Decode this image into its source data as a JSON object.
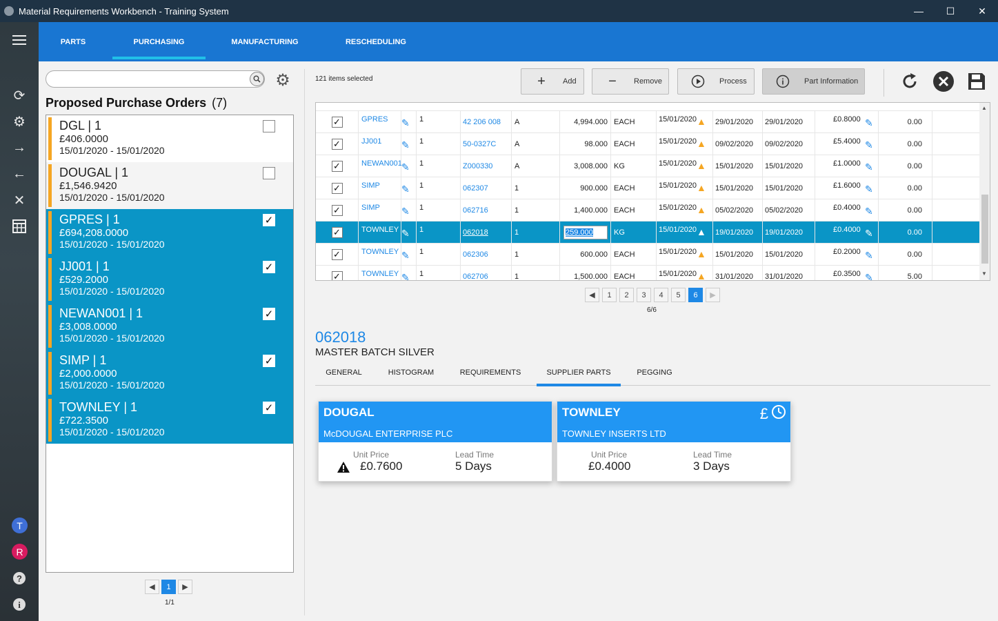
{
  "window": {
    "title": "Material Requirements Workbench - Training System",
    "minimize": "—",
    "maximize": "☐",
    "close": "✕"
  },
  "rail": {
    "avatar_t": "T",
    "avatar_r": "R",
    "colors": {
      "avatar_t": "#3f6fd6",
      "avatar_r": "#d81b60"
    }
  },
  "nav": {
    "tabs": [
      {
        "label": "PARTS"
      },
      {
        "label": "PURCHASING"
      },
      {
        "label": "MANUFACTURING"
      },
      {
        "label": "RESCHEDULING"
      }
    ],
    "active": "PURCHASING"
  },
  "left": {
    "search_placeholder": "",
    "title": "Proposed Purchase Orders",
    "count": "(7)",
    "orders": [
      {
        "name": "DGL | 1",
        "amount": "£406.0000",
        "dates": "15/01/2020 - 15/01/2020",
        "checked": false
      },
      {
        "name": "DOUGAL | 1",
        "amount": "£1,546.9420",
        "dates": "15/01/2020 - 15/01/2020",
        "checked": false
      },
      {
        "name": "GPRES | 1",
        "amount": "£694,208.0000",
        "dates": "15/01/2020 - 15/01/2020",
        "checked": true
      },
      {
        "name": "JJ001 | 1",
        "amount": "£529.2000",
        "dates": "15/01/2020 - 15/01/2020",
        "checked": true
      },
      {
        "name": "NEWAN001 | 1",
        "amount": "£3,008.0000",
        "dates": "15/01/2020 - 15/01/2020",
        "checked": true
      },
      {
        "name": "SIMP | 1",
        "amount": "£2,000.0000",
        "dates": "15/01/2020 - 15/01/2020",
        "checked": true
      },
      {
        "name": "TOWNLEY | 1",
        "amount": "£722.3500",
        "dates": "15/01/2020 - 15/01/2020",
        "checked": true
      }
    ],
    "pager": {
      "prev": "◀",
      "current": "1",
      "next": "▶",
      "info": "1/1"
    }
  },
  "toolbar": {
    "selected_info": "121 items selected",
    "add": "Add",
    "remove": "Remove",
    "process": "Process",
    "part_info": "Part Information"
  },
  "grid": {
    "rows": [
      {
        "supplier": "GPRES",
        "n": "1",
        "part": "42 206 008",
        "rev": "A",
        "qty": "4,994.000",
        "uom": "EACH",
        "date1": "15/01/2020",
        "date2": "29/01/2020",
        "date3": "29/01/2020",
        "price": "£0.8000",
        "extra": "0.00"
      },
      {
        "supplier": "JJ001",
        "n": "1",
        "part": "50-0327C",
        "rev": "A",
        "qty": "98.000",
        "uom": "EACH",
        "date1": "15/01/2020",
        "date2": "09/02/2020",
        "date3": "09/02/2020",
        "price": "£5.4000",
        "extra": "0.00"
      },
      {
        "supplier": "NEWAN001",
        "n": "1",
        "part": "Z000330",
        "rev": "A",
        "qty": "3,008.000",
        "uom": "KG",
        "date1": "15/01/2020",
        "date2": "15/01/2020",
        "date3": "15/01/2020",
        "price": "£1.0000",
        "extra": "0.00"
      },
      {
        "supplier": "SIMP",
        "n": "1",
        "part": "062307",
        "rev": "1",
        "qty": "900.000",
        "uom": "EACH",
        "date1": "15/01/2020",
        "date2": "15/01/2020",
        "date3": "15/01/2020",
        "price": "£1.6000",
        "extra": "0.00"
      },
      {
        "supplier": "SIMP",
        "n": "1",
        "part": "062716",
        "rev": "1",
        "qty": "1,400.000",
        "uom": "EACH",
        "date1": "15/01/2020",
        "date2": "05/02/2020",
        "date3": "05/02/2020",
        "price": "£0.4000",
        "extra": "0.00"
      },
      {
        "supplier": "TOWNLEY",
        "n": "1",
        "part": "062018",
        "rev": "1",
        "qty": "259.000",
        "uom": "KG",
        "date1": "15/01/2020",
        "date2": "19/01/2020",
        "date3": "19/01/2020",
        "price": "£0.4000",
        "extra": "0.00"
      },
      {
        "supplier": "TOWNLEY",
        "n": "1",
        "part": "062306",
        "rev": "1",
        "qty": "600.000",
        "uom": "EACH",
        "date1": "15/01/2020",
        "date2": "15/01/2020",
        "date3": "15/01/2020",
        "price": "£0.2000",
        "extra": "0.00"
      },
      {
        "supplier": "TOWNLEY",
        "n": "1",
        "part": "062706",
        "rev": "1",
        "qty": "1,500.000",
        "uom": "EACH",
        "date1": "15/01/2020",
        "date2": "31/01/2020",
        "date3": "31/01/2020",
        "price": "£0.3500",
        "extra": "5.00"
      }
    ],
    "selected_index": 5,
    "pager": {
      "prev": "◀",
      "pages": [
        "1",
        "2",
        "3",
        "4",
        "5",
        "6"
      ],
      "current": "6",
      "next": "▶",
      "info": "6/6"
    }
  },
  "detail": {
    "part_code": "062018",
    "description": "MASTER BATCH SILVER",
    "tabs": [
      "GENERAL",
      "HISTOGRAM",
      "REQUIREMENTS",
      "SUPPLIER PARTS",
      "PEGGING"
    ],
    "active_tab": "SUPPLIER PARTS",
    "suppliers": [
      {
        "code": "DOUGAL",
        "name": "McDOUGAL ENTERPRISE PLC",
        "unit_price_label": "Unit Price",
        "unit_price": "£0.7600",
        "lead_time_label": "Lead Time",
        "lead_time": "5 Days"
      },
      {
        "code": "TOWNLEY",
        "name": "TOWNLEY INSERTS LTD",
        "unit_price_label": "Unit Price",
        "unit_price": "£0.4000",
        "lead_time_label": "Lead Time",
        "lead_time": "3 Days"
      }
    ],
    "pound_icon": "£"
  }
}
